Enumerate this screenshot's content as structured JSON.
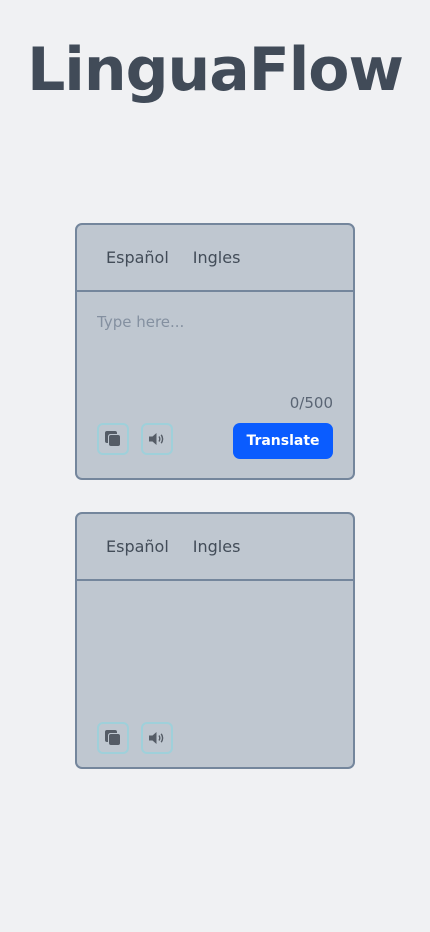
{
  "app": {
    "title": "LinguaFlow"
  },
  "input_panel": {
    "source_language": "Español",
    "target_language": "Ingles",
    "placeholder": "Type here...",
    "text": "",
    "char_count": "0/500",
    "translate_label": "Translate",
    "icons": {
      "copy": "copy-icon",
      "speak": "speaker-icon"
    }
  },
  "output_panel": {
    "source_language": "Español",
    "target_language": "Ingles",
    "text": "",
    "icons": {
      "copy": "copy-icon",
      "speak": "speaker-icon"
    }
  },
  "colors": {
    "background": "#f0f1f3",
    "card": "#bfc7d0",
    "card_border": "#74869c",
    "title": "#414b58",
    "accent": "#0a5cff",
    "icon_border": "#9fd0da"
  }
}
